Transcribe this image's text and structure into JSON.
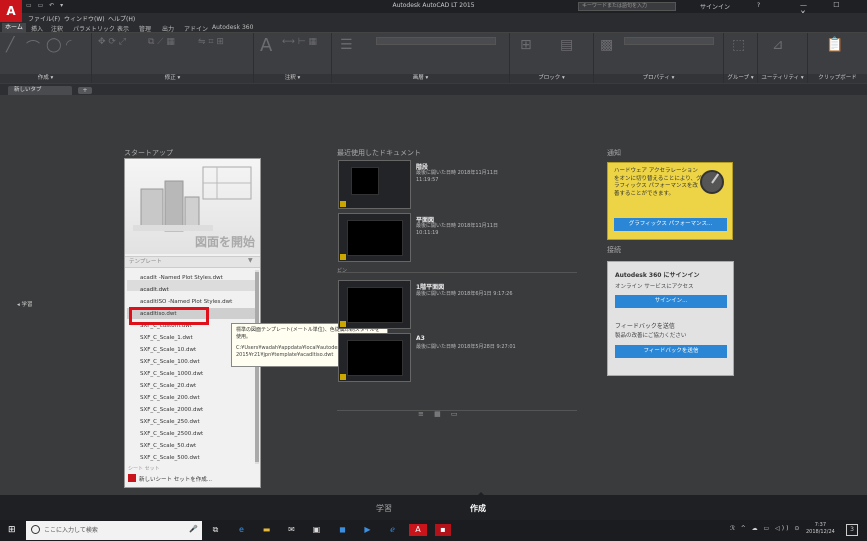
{
  "window": {
    "title": "Autodesk AutoCAD LT 2015",
    "search_placeholder": "キーワードまたは語句を入力",
    "signin": "サインイン",
    "help": "?",
    "controls": "— ☐ ✕"
  },
  "menu": [
    "ファイル(F)",
    "ウィンドウ(W)",
    "ヘルプ(H)"
  ],
  "ribbon_tabs": [
    "ホーム",
    "挿入",
    "注釈",
    "パラメトリック",
    "表示",
    "管理",
    "出力",
    "アドイン",
    "Autodesk 360"
  ],
  "ribbon_panels": [
    "作成 ▾",
    "修正 ▾",
    "注釈 ▾",
    "画層 ▾",
    "ブロック ▾",
    "プロパティ ▾",
    "グループ ▾",
    "ユーティリティ ▾",
    "クリップボード"
  ],
  "doc_tabs": {
    "active": "新しいタブ",
    "add": "+"
  },
  "side_learn": "◂ 学習",
  "start": {
    "heading": "スタートアップ",
    "new_drawing": "図面を開始",
    "template_label": "テンプレート",
    "templates": [
      "acadlt -Named Plot Styles.dwt",
      "acadlt.dwt",
      "acadltISO -Named Plot Styles.dwt",
      "acadltiso.dwt",
      "SXF_C_custom.dwt",
      "SXF_C_Scale_1.dwt",
      "SXF_C_Scale_10.dwt",
      "SXF_C_Scale_100.dwt",
      "SXF_C_Scale_1000.dwt",
      "SXF_C_Scale_20.dwt",
      "SXF_C_Scale_200.dwt",
      "SXF_C_Scale_2000.dwt",
      "SXF_C_Scale_250.dwt",
      "SXF_C_Scale_2500.dwt",
      "SXF_C_Scale_50.dwt",
      "SXF_C_Scale_500.dwt"
    ],
    "sheetset_label": "シート セット",
    "sheetset_create": "新しいシート セットを作成..."
  },
  "tooltip": {
    "text": "標準の図面テンプレート(メートル単位)、色従属印刷スタイルを使用。",
    "path": "C:¥Users¥wadah¥appdata¥local¥autodesk¥autocad lt 2015¥r21¥jpn¥template¥acadltiso.dwt"
  },
  "recent": {
    "heading": "最近使用したドキュメント",
    "pinned_label": "ピン",
    "docs": [
      {
        "title": "階段",
        "meta": "最後に開いた日時 2018年11月11日 11:19:57"
      },
      {
        "title": "平面図",
        "meta": "最後に開いた日時 2018年11月11日 10:11:19"
      },
      {
        "title": "1階平面図",
        "meta": "最後に開いた日時 2018年6月1日 9:17:26"
      },
      {
        "title": "A3",
        "meta": "最後に開いた日時 2018年5月28日 9:27:01"
      }
    ],
    "view_toggle": "≡ ▦ ▭"
  },
  "notifications": {
    "heading": "通知",
    "message": "ハードウェア アクセラレーションをオンに切り替えることにより、グラフィックス パフォーマンスを改善することができます。",
    "button": "グラフィックス パフォーマンス..."
  },
  "connect": {
    "heading": "接続",
    "a360_title": "Autodesk 360 にサインイン",
    "a360_sub": "オンライン サービスにアクセス",
    "a360_button": "サインイン...",
    "feedback_title": "フィードバックを送信",
    "feedback_sub": "製品の改善にご協力ください",
    "feedback_button": "フィードバックを送信"
  },
  "bottom": {
    "learn": "学習",
    "create": "作成"
  },
  "taskbar": {
    "search_placeholder": "ここに入力して検索",
    "time": "7:37",
    "date": "2018/12/24",
    "notify": "3"
  },
  "colors": {
    "accent": "#2b87d5",
    "brand": "#c9141c",
    "notice": "#ecd446",
    "highlight_box": "#e0101a"
  }
}
